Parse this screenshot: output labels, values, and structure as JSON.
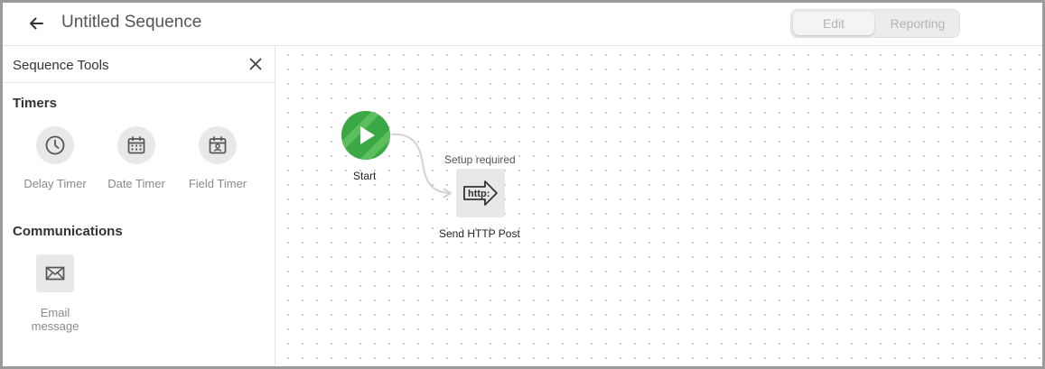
{
  "header": {
    "title": "Untitled Sequence",
    "back_icon": "arrow-left-icon",
    "mode_toggle": {
      "edit_label": "Edit",
      "reporting_label": "Reporting",
      "selected": "Edit"
    }
  },
  "sidebar": {
    "title": "Sequence Tools",
    "close_icon": "close-icon",
    "sections": [
      {
        "title": "Timers",
        "tools": [
          {
            "label": "Delay Timer",
            "icon": "clock-icon"
          },
          {
            "label": "Date Timer",
            "icon": "calendar-icon"
          },
          {
            "label": "Field Timer",
            "icon": "calendar-person-icon"
          }
        ]
      },
      {
        "title": "Communications",
        "tools": [
          {
            "label": "Email message",
            "icon": "envelope-icon"
          }
        ]
      }
    ]
  },
  "canvas": {
    "nodes": [
      {
        "label": "Start",
        "icon": "play-icon",
        "color": "#3aa845"
      },
      {
        "label": "Send HTTP Post",
        "status": "Setup required",
        "icon": "http-arrow-icon"
      }
    ]
  },
  "colors": {
    "start_green": "#3aa845",
    "start_green_light": "#5cbf5e",
    "node_gray": "#e8e8e8",
    "muted_text": "#8a8a8a"
  }
}
